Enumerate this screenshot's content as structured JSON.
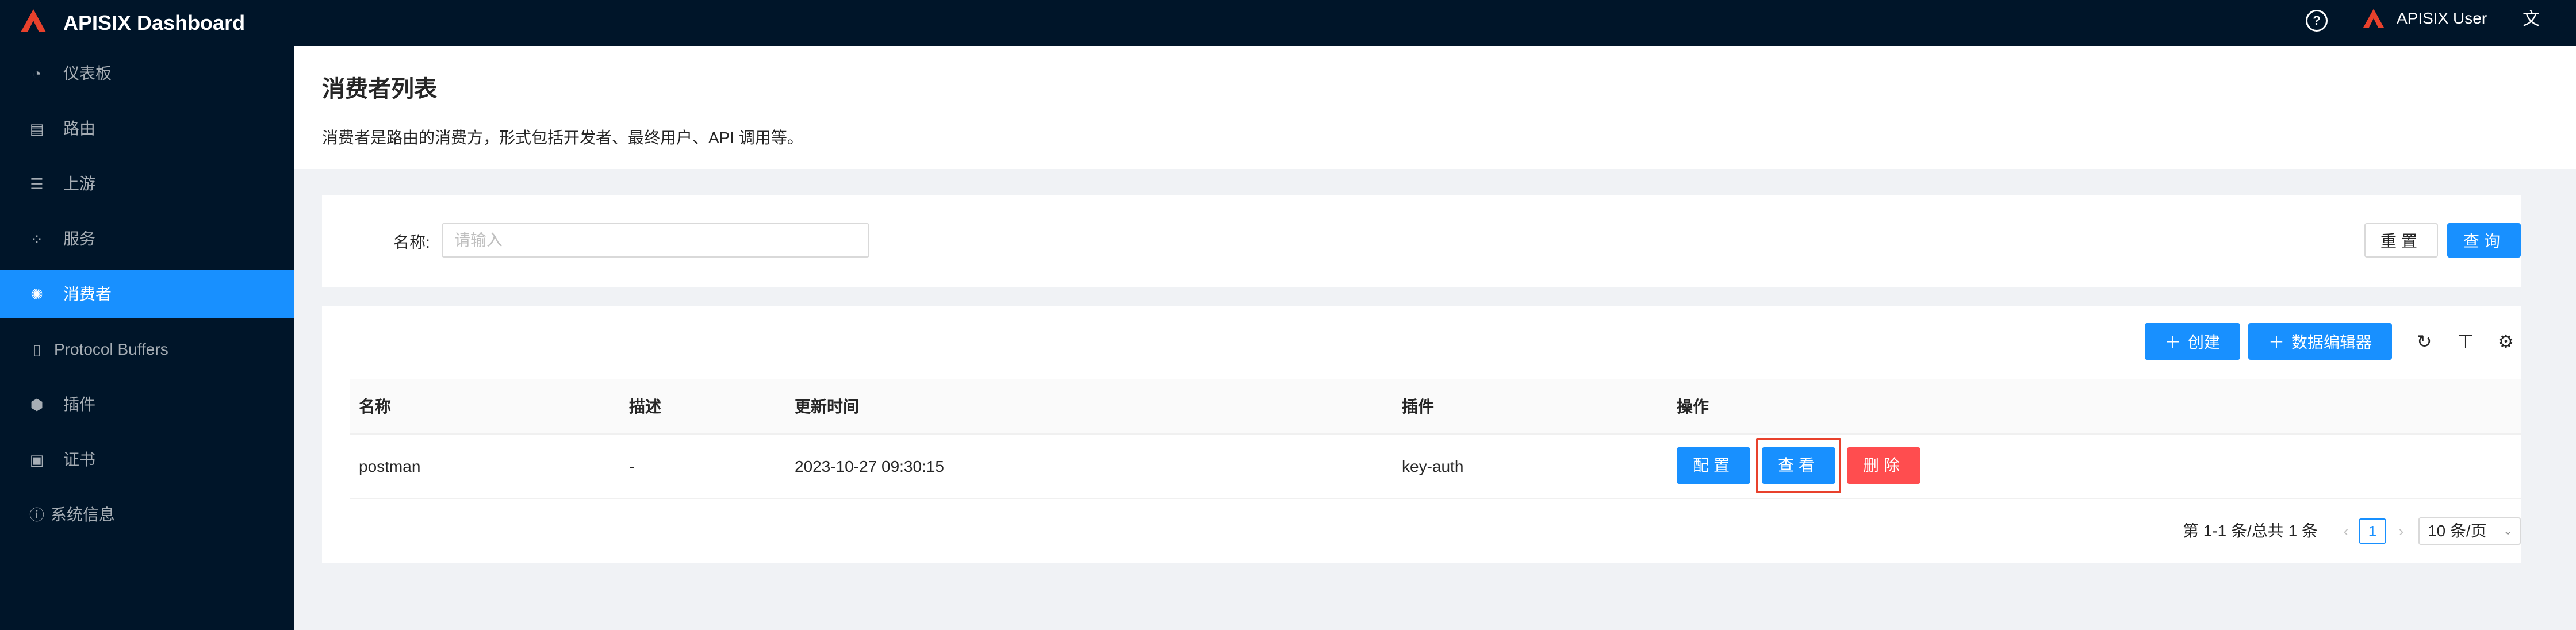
{
  "app": {
    "title": "APISIX Dashboard",
    "user": "APISIX User"
  },
  "icons": {
    "help": "question-circle-icon",
    "lang": "translate-icon",
    "logo": "apisix-logo"
  },
  "colors": {
    "header_bg": "#001529",
    "primary": "#1890ff",
    "danger": "#ff4d4f",
    "highlight": "#e8412c"
  },
  "sidebar": {
    "items": [
      {
        "label": "仪表板",
        "icon": "dashboard-icon",
        "glyph": "◔"
      },
      {
        "label": "路由",
        "icon": "route-icon",
        "glyph": "▤"
      },
      {
        "label": "上游",
        "icon": "upstream-icon",
        "glyph": "☰"
      },
      {
        "label": "服务",
        "icon": "service-icon",
        "glyph": "⁘"
      },
      {
        "label": "消费者",
        "icon": "consumer-icon",
        "glyph": "✺",
        "active": true
      },
      {
        "label": "Protocol Buffers",
        "icon": "protobuf-icon",
        "glyph": "▯"
      },
      {
        "label": "插件",
        "icon": "plugin-icon",
        "glyph": "⬢"
      },
      {
        "label": "证书",
        "icon": "certificate-icon",
        "glyph": "▣"
      },
      {
        "label": "系统信息",
        "icon": "info-icon",
        "glyph": "ⓘ"
      }
    ]
  },
  "page": {
    "title": "消费者列表",
    "description": "消费者是路由的消费方，形式包括开发者、最终用户、API 调用等。"
  },
  "search": {
    "label": "名称:",
    "placeholder": "请输入",
    "value": "",
    "reset": "重置",
    "query": "查询"
  },
  "toolbar": {
    "create": "创建",
    "data_editor": "数据编辑器",
    "refresh_icon": "reload-icon",
    "density_icon": "column-height-icon",
    "settings_icon": "setting-icon"
  },
  "table": {
    "headers": [
      "名称",
      "描述",
      "更新时间",
      "插件",
      "操作"
    ],
    "rows": [
      {
        "name": "postman",
        "desc": "-",
        "updated": "2023-10-27 09:30:15",
        "plugins": "key-auth",
        "actions": {
          "configure": "配置",
          "view": "查看",
          "delete": "删除"
        }
      }
    ]
  },
  "pagination": {
    "total_text": "第 1-1 条/总共 1 条",
    "current": "1",
    "page_size": "10 条/页"
  }
}
